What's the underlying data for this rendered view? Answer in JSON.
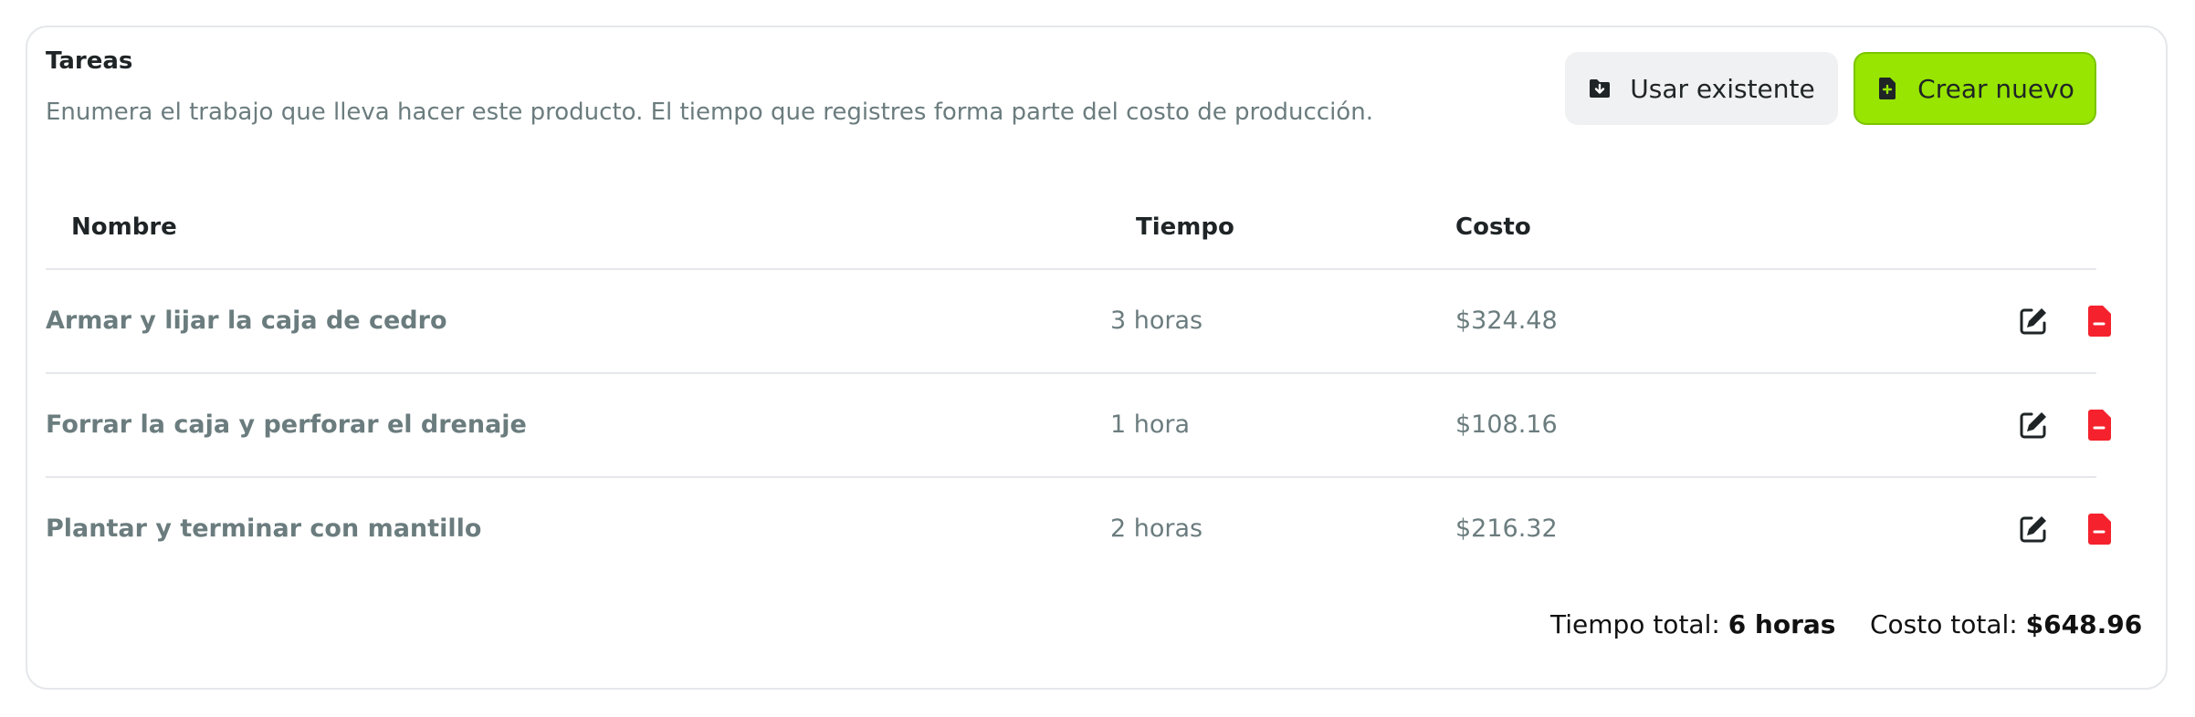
{
  "section": {
    "title": "Tareas",
    "description": "Enumera el trabajo que lleva hacer este producto. El tiempo que registres forma parte del costo de producción."
  },
  "actions": {
    "use_existing_label": "Usar existente",
    "use_existing_icon": "folder-download-icon",
    "create_new_label": "Crear nuevo",
    "create_new_icon": "file-plus-icon",
    "create_new_color": "#97e500"
  },
  "table": {
    "columns": [
      "Nombre",
      "Tiempo",
      "Costo"
    ],
    "rows": [
      {
        "name": "Armar y lijar la caja de cedro",
        "time": "3 horas",
        "cost": "$324.48"
      },
      {
        "name": "Forrar la caja y perforar el drenaje",
        "time": "1 hora",
        "cost": "$108.16"
      },
      {
        "name": "Plantar y terminar con mantillo",
        "time": "2 horas",
        "cost": "$216.32"
      }
    ],
    "row_actions": {
      "edit_icon": "edit-icon",
      "delete_icon": "file-minus-icon",
      "delete_color": "#f5222d"
    }
  },
  "totals": {
    "time_label": "Tiempo total:",
    "time_value": "6 horas",
    "cost_label": "Costo total:",
    "cost_value": "$648.96"
  }
}
